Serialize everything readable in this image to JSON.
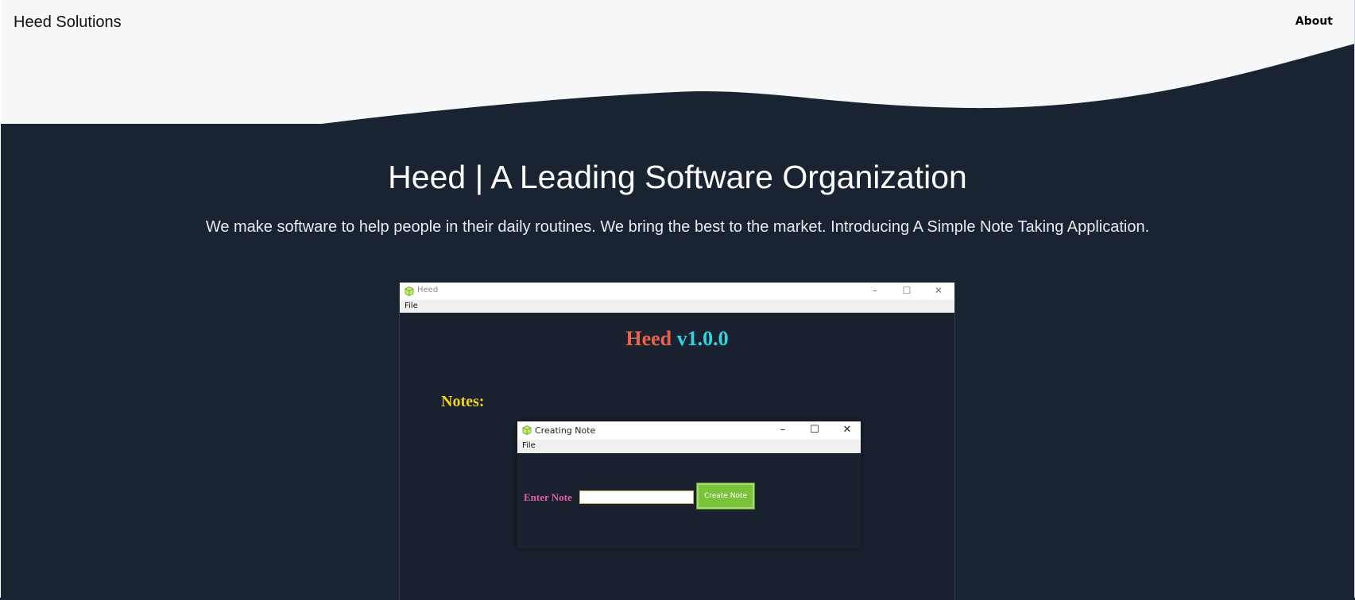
{
  "header": {
    "brand": "Heed Solutions",
    "nav_about": "About"
  },
  "hero": {
    "title": "Heed | A Leading Software Organization",
    "subtitle": "We make software to help people in their daily routines. We bring the best to the market. Introducing A Simple Note Taking Application."
  },
  "app_window": {
    "title": "Heed",
    "menu_file": "File",
    "heading_name": "Heed",
    "heading_version": "v1.0.0",
    "notes_label": "Notes:",
    "controls": {
      "minimize": "–",
      "maximize": "☐",
      "close": "✕"
    }
  },
  "dialog": {
    "title": "Creating Note",
    "menu_file": "File",
    "enter_label": "Enter Note",
    "note_value": "",
    "create_button": "Create Note",
    "controls": {
      "minimize": "–",
      "maximize": "☐",
      "close": "✕"
    }
  },
  "colors": {
    "background": "#1a2332",
    "header_bg": "#f7f8fa",
    "heading_name": "#e8634a",
    "heading_version": "#2fd5e0",
    "notes_label": "#f2d21e",
    "enter_label": "#e35da8",
    "create_button": "#7bc23b"
  },
  "icons": {
    "app_icon": "green-cube-icon"
  }
}
